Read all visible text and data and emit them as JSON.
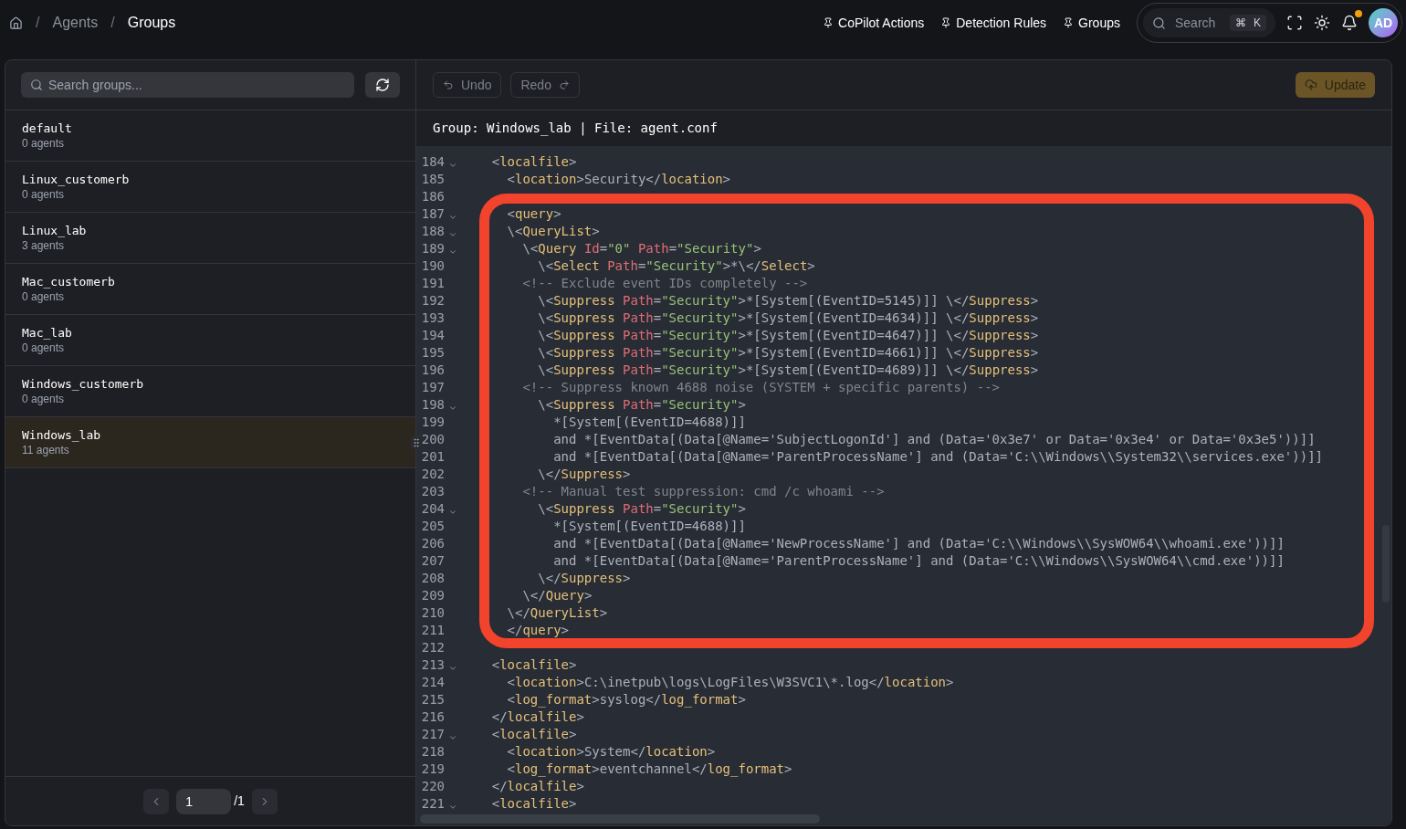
{
  "breadcrumb": [
    {
      "separator": "/",
      "label": "Agents",
      "selected": false
    },
    {
      "separator": "/",
      "label": "Groups",
      "selected": true
    }
  ],
  "pinned_links": [
    "CoPilot Actions",
    "Detection Rules",
    "Groups"
  ],
  "global_search": {
    "placeholder": "Search",
    "shortcut": [
      "⌘",
      "K"
    ]
  },
  "notifications": {
    "unread": true
  },
  "avatar": {
    "initials": "AD"
  },
  "sidebar": {
    "search_placeholder": "Search groups...",
    "groups": [
      {
        "name": "default",
        "agents": "0 agents",
        "selected": false
      },
      {
        "name": "Linux_customerb",
        "agents": "0 agents",
        "selected": false
      },
      {
        "name": "Linux_lab",
        "agents": "3 agents",
        "selected": false
      },
      {
        "name": "Mac_customerb",
        "agents": "0 agents",
        "selected": false
      },
      {
        "name": "Mac_lab",
        "agents": "0 agents",
        "selected": false
      },
      {
        "name": "Windows_customerb",
        "agents": "0 agents",
        "selected": false
      },
      {
        "name": "Windows_lab",
        "agents": "11 agents",
        "selected": true
      }
    ],
    "pagination": {
      "page": "1",
      "total": "/1"
    }
  },
  "editor": {
    "undo": {
      "label": "Undo",
      "disabled": true
    },
    "redo": {
      "label": "Redo",
      "disabled": true
    },
    "update": {
      "label": "Update",
      "disabled": true
    },
    "file_header": "Group: Windows_lab | File: agent.conf",
    "highlight": {
      "kind": "rectangle"
    },
    "lines": [
      {
        "number": "184",
        "foldable": true,
        "tokens": [
          {
            "kind": "plain",
            "text": "    <"
          },
          {
            "kind": "tag",
            "text": "localfile"
          },
          {
            "kind": "plain",
            "text": ">"
          }
        ]
      },
      {
        "number": "185",
        "foldable": false,
        "tokens": [
          {
            "kind": "plain",
            "text": "      <"
          },
          {
            "kind": "tag",
            "text": "location"
          },
          {
            "kind": "plain",
            "text": ">Security</"
          },
          {
            "kind": "tag",
            "text": "location"
          },
          {
            "kind": "plain",
            "text": ">"
          }
        ]
      },
      {
        "number": "186",
        "foldable": false
      },
      {
        "number": "187",
        "foldable": true,
        "tokens": [
          {
            "kind": "plain",
            "text": "      <"
          },
          {
            "kind": "tag",
            "text": "query"
          },
          {
            "kind": "plain",
            "text": ">"
          }
        ]
      },
      {
        "number": "188",
        "foldable": true,
        "tokens": [
          {
            "kind": "plain",
            "text": "      \\<"
          },
          {
            "kind": "tag",
            "text": "QueryList"
          },
          {
            "kind": "plain",
            "text": ">"
          }
        ]
      },
      {
        "number": "189",
        "foldable": true,
        "tokens": [
          {
            "kind": "plain",
            "text": "        \\<"
          },
          {
            "kind": "tag",
            "text": "Query"
          },
          {
            "kind": "attr",
            "text": " Id"
          },
          {
            "kind": "plain",
            "text": "="
          },
          {
            "kind": "string",
            "text": "\"0\""
          },
          {
            "kind": "attr",
            "text": " Path"
          },
          {
            "kind": "plain",
            "text": "="
          },
          {
            "kind": "string",
            "text": "\"Security\""
          },
          {
            "kind": "plain",
            "text": ">"
          }
        ]
      },
      {
        "number": "190",
        "foldable": false,
        "tokens": [
          {
            "kind": "plain",
            "text": "          \\<"
          },
          {
            "kind": "tag",
            "text": "Select"
          },
          {
            "kind": "attr",
            "text": " Path"
          },
          {
            "kind": "plain",
            "text": "="
          },
          {
            "kind": "string",
            "text": "\"Security\""
          },
          {
            "kind": "plain",
            "text": ">*\\</"
          },
          {
            "kind": "tag",
            "text": "Select"
          },
          {
            "kind": "plain",
            "text": ">"
          }
        ]
      },
      {
        "number": "191",
        "foldable": false,
        "tokens": [
          {
            "kind": "comment",
            "text": "        <!-- Exclude event IDs completely -->"
          }
        ]
      },
      {
        "number": "192",
        "foldable": false,
        "tokens": [
          {
            "kind": "plain",
            "text": "          \\<"
          },
          {
            "kind": "tag",
            "text": "Suppress"
          },
          {
            "kind": "attr",
            "text": " Path"
          },
          {
            "kind": "plain",
            "text": "="
          },
          {
            "kind": "string",
            "text": "\"Security\""
          },
          {
            "kind": "plain",
            "text": ">*[System[(EventID=5145)]] \\</"
          },
          {
            "kind": "tag",
            "text": "Suppress"
          },
          {
            "kind": "plain",
            "text": ">"
          }
        ]
      },
      {
        "number": "193",
        "foldable": false,
        "tokens": [
          {
            "kind": "plain",
            "text": "          \\<"
          },
          {
            "kind": "tag",
            "text": "Suppress"
          },
          {
            "kind": "attr",
            "text": " Path"
          },
          {
            "kind": "plain",
            "text": "="
          },
          {
            "kind": "string",
            "text": "\"Security\""
          },
          {
            "kind": "plain",
            "text": ">*[System[(EventID=4634)]] \\</"
          },
          {
            "kind": "tag",
            "text": "Suppress"
          },
          {
            "kind": "plain",
            "text": ">"
          }
        ]
      },
      {
        "number": "194",
        "foldable": false,
        "tokens": [
          {
            "kind": "plain",
            "text": "          \\<"
          },
          {
            "kind": "tag",
            "text": "Suppress"
          },
          {
            "kind": "attr",
            "text": " Path"
          },
          {
            "kind": "plain",
            "text": "="
          },
          {
            "kind": "string",
            "text": "\"Security\""
          },
          {
            "kind": "plain",
            "text": ">*[System[(EventID=4647)]] \\</"
          },
          {
            "kind": "tag",
            "text": "Suppress"
          },
          {
            "kind": "plain",
            "text": ">"
          }
        ]
      },
      {
        "number": "195",
        "foldable": false,
        "tokens": [
          {
            "kind": "plain",
            "text": "          \\<"
          },
          {
            "kind": "tag",
            "text": "Suppress"
          },
          {
            "kind": "attr",
            "text": " Path"
          },
          {
            "kind": "plain",
            "text": "="
          },
          {
            "kind": "string",
            "text": "\"Security\""
          },
          {
            "kind": "plain",
            "text": ">*[System[(EventID=4661)]] \\</"
          },
          {
            "kind": "tag",
            "text": "Suppress"
          },
          {
            "kind": "plain",
            "text": ">"
          }
        ]
      },
      {
        "number": "196",
        "foldable": false,
        "tokens": [
          {
            "kind": "plain",
            "text": "          \\<"
          },
          {
            "kind": "tag",
            "text": "Suppress"
          },
          {
            "kind": "attr",
            "text": " Path"
          },
          {
            "kind": "plain",
            "text": "="
          },
          {
            "kind": "string",
            "text": "\"Security\""
          },
          {
            "kind": "plain",
            "text": ">*[System[(EventID=4689)]] \\</"
          },
          {
            "kind": "tag",
            "text": "Suppress"
          },
          {
            "kind": "plain",
            "text": ">"
          }
        ]
      },
      {
        "number": "197",
        "foldable": false,
        "tokens": [
          {
            "kind": "comment",
            "text": "        <!-- Suppress known 4688 noise (SYSTEM + specific parents) -->"
          }
        ]
      },
      {
        "number": "198",
        "foldable": true,
        "tokens": [
          {
            "kind": "plain",
            "text": "          \\<"
          },
          {
            "kind": "tag",
            "text": "Suppress"
          },
          {
            "kind": "attr",
            "text": " Path"
          },
          {
            "kind": "plain",
            "text": "="
          },
          {
            "kind": "string",
            "text": "\"Security\""
          },
          {
            "kind": "plain",
            "text": ">"
          }
        ]
      },
      {
        "number": "199",
        "foldable": false,
        "tokens": [
          {
            "kind": "plain",
            "text": "            *[System[(EventID=4688)]]"
          }
        ]
      },
      {
        "number": "200",
        "foldable": false,
        "tokens": [
          {
            "kind": "plain",
            "text": "            and *[EventData[(Data[@Name='SubjectLogonId'] and (Data='0x3e7' or Data='0x3e4' or Data='0x3e5'))]]"
          }
        ]
      },
      {
        "number": "201",
        "foldable": false,
        "tokens": [
          {
            "kind": "plain",
            "text": "            and *[EventData[(Data[@Name='ParentProcessName'] and (Data='C:\\\\Windows\\\\System32\\\\services.exe'))]]"
          }
        ]
      },
      {
        "number": "202",
        "foldable": false,
        "tokens": [
          {
            "kind": "plain",
            "text": "          \\</"
          },
          {
            "kind": "tag",
            "text": "Suppress"
          },
          {
            "kind": "plain",
            "text": ">"
          }
        ]
      },
      {
        "number": "203",
        "foldable": false,
        "tokens": [
          {
            "kind": "comment",
            "text": "        <!-- Manual test suppression: cmd /c whoami -->"
          }
        ]
      },
      {
        "number": "204",
        "foldable": true,
        "tokens": [
          {
            "kind": "plain",
            "text": "          \\<"
          },
          {
            "kind": "tag",
            "text": "Suppress"
          },
          {
            "kind": "attr",
            "text": " Path"
          },
          {
            "kind": "plain",
            "text": "="
          },
          {
            "kind": "string",
            "text": "\"Security\""
          },
          {
            "kind": "plain",
            "text": ">"
          }
        ]
      },
      {
        "number": "205",
        "foldable": false,
        "tokens": [
          {
            "kind": "plain",
            "text": "            *[System[(EventID=4688)]]"
          }
        ]
      },
      {
        "number": "206",
        "foldable": false,
        "tokens": [
          {
            "kind": "plain",
            "text": "            and *[EventData[(Data[@Name='NewProcessName'] and (Data='C:\\\\Windows\\\\SysWOW64\\\\whoami.exe'))]]"
          }
        ]
      },
      {
        "number": "207",
        "foldable": false,
        "tokens": [
          {
            "kind": "plain",
            "text": "            and *[EventData[(Data[@Name='ParentProcessName'] and (Data='C:\\\\Windows\\\\SysWOW64\\\\cmd.exe'))]]"
          }
        ]
      },
      {
        "number": "208",
        "foldable": false,
        "tokens": [
          {
            "kind": "plain",
            "text": "          \\</"
          },
          {
            "kind": "tag",
            "text": "Suppress"
          },
          {
            "kind": "plain",
            "text": ">"
          }
        ]
      },
      {
        "number": "209",
        "foldable": false,
        "tokens": [
          {
            "kind": "plain",
            "text": "        \\</"
          },
          {
            "kind": "tag",
            "text": "Query"
          },
          {
            "kind": "plain",
            "text": ">"
          }
        ]
      },
      {
        "number": "210",
        "foldable": false,
        "tokens": [
          {
            "kind": "plain",
            "text": "      \\</"
          },
          {
            "kind": "tag",
            "text": "QueryList"
          },
          {
            "kind": "plain",
            "text": ">"
          }
        ]
      },
      {
        "number": "211",
        "foldable": false,
        "tokens": [
          {
            "kind": "plain",
            "text": "      </"
          },
          {
            "kind": "tag",
            "text": "query"
          },
          {
            "kind": "plain",
            "text": ">"
          }
        ]
      },
      {
        "number": "212",
        "foldable": false
      },
      {
        "number": "213",
        "foldable": true,
        "tokens": [
          {
            "kind": "plain",
            "text": "    <"
          },
          {
            "kind": "tag",
            "text": "localfile"
          },
          {
            "kind": "plain",
            "text": ">"
          }
        ]
      },
      {
        "number": "214",
        "foldable": false,
        "tokens": [
          {
            "kind": "plain",
            "text": "      <"
          },
          {
            "kind": "tag",
            "text": "location"
          },
          {
            "kind": "plain",
            "text": ">C:\\inetpub\\logs\\LogFiles\\W3SVC1\\*.log</"
          },
          {
            "kind": "tag",
            "text": "location"
          },
          {
            "kind": "plain",
            "text": ">"
          }
        ]
      },
      {
        "number": "215",
        "foldable": false,
        "tokens": [
          {
            "kind": "plain",
            "text": "      <"
          },
          {
            "kind": "tag",
            "text": "log_format"
          },
          {
            "kind": "plain",
            "text": ">syslog</"
          },
          {
            "kind": "tag",
            "text": "log_format"
          },
          {
            "kind": "plain",
            "text": ">"
          }
        ]
      },
      {
        "number": "216",
        "foldable": false,
        "tokens": [
          {
            "kind": "plain",
            "text": "    </"
          },
          {
            "kind": "tag",
            "text": "localfile"
          },
          {
            "kind": "plain",
            "text": ">"
          }
        ]
      },
      {
        "number": "217",
        "foldable": true,
        "tokens": [
          {
            "kind": "plain",
            "text": "    <"
          },
          {
            "kind": "tag",
            "text": "localfile"
          },
          {
            "kind": "plain",
            "text": ">"
          }
        ]
      },
      {
        "number": "218",
        "foldable": false,
        "tokens": [
          {
            "kind": "plain",
            "text": "      <"
          },
          {
            "kind": "tag",
            "text": "location"
          },
          {
            "kind": "plain",
            "text": ">System</"
          },
          {
            "kind": "tag",
            "text": "location"
          },
          {
            "kind": "plain",
            "text": ">"
          }
        ]
      },
      {
        "number": "219",
        "foldable": false,
        "tokens": [
          {
            "kind": "plain",
            "text": "      <"
          },
          {
            "kind": "tag",
            "text": "log_format"
          },
          {
            "kind": "plain",
            "text": ">eventchannel</"
          },
          {
            "kind": "tag",
            "text": "log_format"
          },
          {
            "kind": "plain",
            "text": ">"
          }
        ]
      },
      {
        "number": "220",
        "foldable": false,
        "tokens": [
          {
            "kind": "plain",
            "text": "    </"
          },
          {
            "kind": "tag",
            "text": "localfile"
          },
          {
            "kind": "plain",
            "text": ">"
          }
        ]
      },
      {
        "number": "221",
        "foldable": true,
        "tokens": [
          {
            "kind": "plain",
            "text": "    <"
          },
          {
            "kind": "tag",
            "text": "localfile"
          },
          {
            "kind": "plain",
            "text": ">"
          }
        ]
      }
    ]
  }
}
